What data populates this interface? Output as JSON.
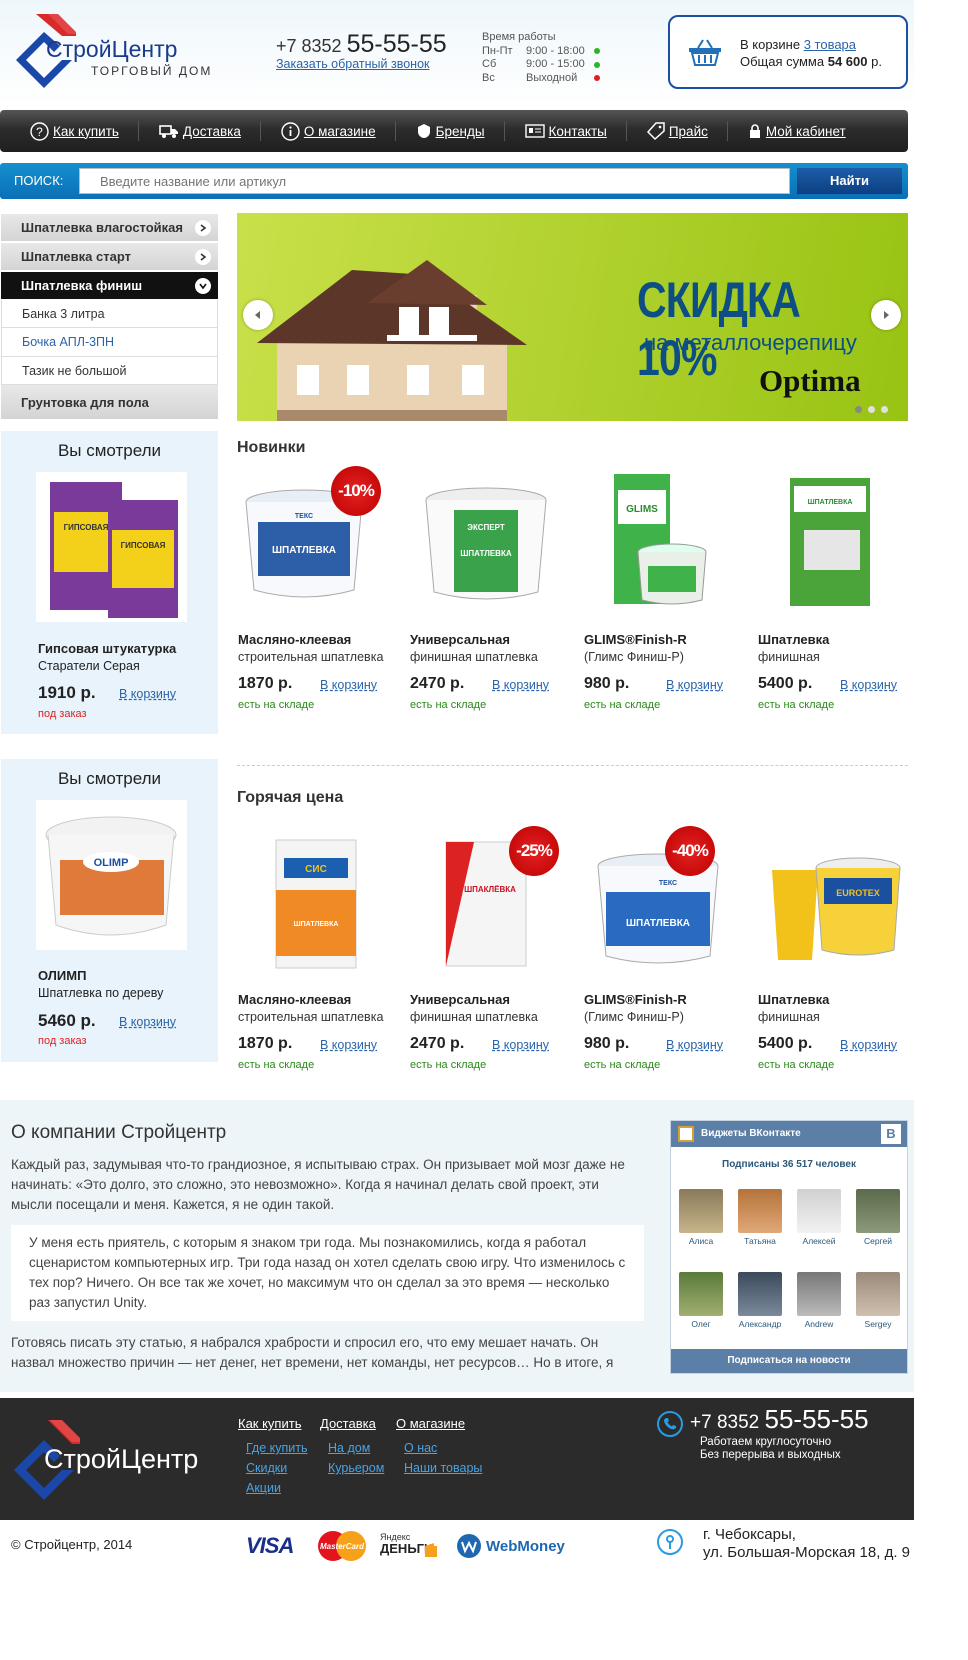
{
  "header": {
    "logo_name": "СтройЦентр",
    "logo_sub": "ТОРГОВЫЙ ДОМ",
    "phone_prefix": "+7 8352",
    "phone_number": "55-55-55",
    "callback": "Заказать обратный звонок",
    "hours_title": "Время работы",
    "hours": [
      {
        "day": "Пн-Пт",
        "time": "9:00 - 18:00",
        "status_color": "#2bb52b"
      },
      {
        "day": "Сб",
        "time": "9:00 - 15:00",
        "status_color": "#2bb52b"
      },
      {
        "day": "Вс",
        "time": "Выходной",
        "status_color": "#e02020"
      }
    ],
    "cart_prefix": "В корзине",
    "cart_count": "3 товара",
    "cart_sum_label": "Общая сумма",
    "cart_sum": "54 600",
    "cart_currency": "р."
  },
  "nav": [
    {
      "label": "Как купить",
      "icon": "question-icon"
    },
    {
      "label": "Доставка",
      "icon": "truck-icon"
    },
    {
      "label": "О магазине",
      "icon": "info-icon"
    },
    {
      "label": "Бренды",
      "icon": "badge-icon"
    },
    {
      "label": "Контакты",
      "icon": "contact-card-icon"
    },
    {
      "label": "Прайс",
      "icon": "tag-icon"
    },
    {
      "label": "Мой кабинет",
      "icon": "lock-icon"
    }
  ],
  "search": {
    "label": "ПОИСК:",
    "placeholder": "Введите название или артикул",
    "button": "Найти"
  },
  "categories": [
    "Шпатлевка влагостойкая",
    "Шпатлевка старт",
    "Шпатлевка финиш",
    "Грунтовка для пола"
  ],
  "subcategories": [
    "Банка 3 литра",
    "Бочка АПЛ-3ПН",
    "Тазик не большой"
  ],
  "banner": {
    "headline": "СКИДКА 10%",
    "subline": "на металлочерепицу",
    "brand": "Optima",
    "active_slide": 1,
    "slides": 3
  },
  "viewed": [
    {
      "title": "Вы смотрели",
      "name": "Гипсовая штукатурка",
      "desc": "Старатели Серая",
      "price": "1910 р.",
      "cart": "В корзину",
      "note": "под заказ"
    },
    {
      "title": "Вы смотрели",
      "name": "ОЛИМП",
      "desc": "Шпатлевка по дереву",
      "price": "5460 р.",
      "cart": "В корзину",
      "note": "под заказ"
    }
  ],
  "sections": [
    {
      "title": "Новинки",
      "products": [
        {
          "name": "Масляно-клеевая",
          "desc": "строительная шпатлевка",
          "price": "1870 р.",
          "cart": "В корзину",
          "stock": "есть на складе",
          "discount": "-10%"
        },
        {
          "name": "Универсальная",
          "desc": "финишная шпатлевка",
          "price": "2470 р.",
          "cart": "В корзину",
          "stock": "есть на складе",
          "discount": ""
        },
        {
          "name": "GLIMS®Finish-R",
          "desc": "(Глимс Финиш-Р)",
          "price": "980 р.",
          "cart": "В корзину",
          "stock": "есть на складе",
          "discount": ""
        },
        {
          "name": "Шпатлевка",
          "desc": "финишная",
          "price": "5400 р.",
          "cart": "В корзину",
          "stock": "есть на складе",
          "discount": ""
        }
      ]
    },
    {
      "title": "Горячая цена",
      "products": [
        {
          "name": "Масляно-клеевая",
          "desc": "строительная шпатлевка",
          "price": "1870 р.",
          "cart": "В корзину",
          "stock": "есть на складе",
          "discount": ""
        },
        {
          "name": "Универсальная",
          "desc": "финишная шпатлевка",
          "price": "2470 р.",
          "cart": "В корзину",
          "stock": "есть на складе",
          "discount": "-25%"
        },
        {
          "name": "GLIMS®Finish-R",
          "desc": "(Глимс Финиш-Р)",
          "price": "980 р.",
          "cart": "В корзину",
          "stock": "есть на складе",
          "discount": "-40%"
        },
        {
          "name": "Шпатлевка",
          "desc": "финишная",
          "price": "5400 р.",
          "cart": "В корзину",
          "stock": "есть на складе",
          "discount": ""
        }
      ]
    }
  ],
  "product_labels": {
    "tex_label": "ТЕКС",
    "spatlevka": "ШПАТЛЕВКА",
    "expert": "ЭКСПЕРТ",
    "glims": "GLIMS",
    "gs": "СИС",
    "shpaklevka": "ШПАКЛЁВКА",
    "eurotex": "EUROTEX",
    "olimp": "OLIMP",
    "gips": "ГИПСОВАЯ"
  },
  "about": {
    "title": "О компании Стройцентр",
    "p1": "Каждый раз, задумывая что-то грандиозное, я испытываю страх. Он призывает мой мозг даже не начинать: «Это долго, это сложно, это невозможно». Когда я начинал делать свой проект, эти мысли посещали и меня. Кажется, я не один такой.",
    "quote": "У меня есть приятель, с которым я знаком три года. Мы познакомились, когда я работал сценаристом компьютерных игр. Три года назад он хотел сделать свою игру. Что изменилось с тех пор? Ничего. Он все так же хочет, но максимум что он сделал за это время — несколько раз запустил Unity.",
    "p2": "Готовясь писать эту статью, я набрался храбрости и спросил его, что ему мешает начать. Он назвал множество причин — нет денег, нет времени, нет команды, нет ресурсов… Но в итоге, я"
  },
  "vk": {
    "title": "Виджеты ВКонтакте",
    "logo": "B",
    "subscribers": "Подписаны 36 517 человек",
    "users": [
      "Алиса",
      "Татьяна",
      "Алексей",
      "Сергей",
      "Олег",
      "Александр",
      "Andrew",
      "Sergey"
    ],
    "button": "Подписаться на новости"
  },
  "footer": {
    "columns": [
      {
        "main": "Как купить",
        "subs": [
          "Где купить",
          "Скидки",
          "Акции"
        ]
      },
      {
        "main": "Доставка",
        "subs": [
          "На дом",
          "Курьером"
        ]
      },
      {
        "main": "О магазине",
        "subs": [
          "О нас",
          "Наши товары"
        ]
      }
    ],
    "phone_prefix": "+7 8352",
    "phone_number": "55-55-55",
    "hours_line1": "Работаем круглосуточно",
    "hours_line2": "Без перерыва и выходных",
    "copyright": "© Стройцентр, 2014",
    "payments": [
      "VISA",
      "MasterCard",
      "Яндекс",
      "ДЕНЬГИ",
      "WebMoney"
    ],
    "city": "г. Чебоксары,",
    "street": "ул. Большая-Морская 18, д. 9"
  }
}
